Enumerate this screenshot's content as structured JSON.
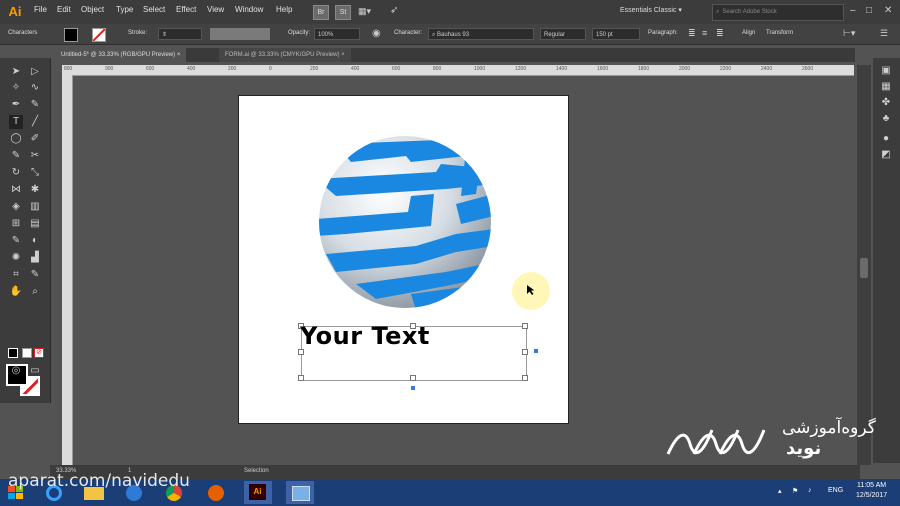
{
  "app": {
    "logo": "Ai",
    "workspace": "Essentials Classic",
    "search_placeholder": "Search Adobe Stock"
  },
  "menu": [
    "File",
    "Edit",
    "Object",
    "Type",
    "Select",
    "Effect",
    "View",
    "Window",
    "Help"
  ],
  "menubar_icons": [
    "Br",
    "St"
  ],
  "control_bar": {
    "panel_label": "Characters",
    "stroke_label": "Stroke:",
    "opacity_label": "Opacity:",
    "opacity_value": "100%",
    "character_label": "Character:",
    "font_name": "Bauhaus 93",
    "font_style": "Regular",
    "font_size": "150 pt",
    "paragraph_label": "Paragraph:",
    "align_label": "Align",
    "transform_label": "Transform"
  },
  "tabs": [
    {
      "label": "Untitled-5* @ 33.33% (RGB/GPU Preview)",
      "close": "×"
    },
    {
      "label": "FORM.ai @ 33.33% (CMYK/GPU Preview)",
      "close": "×"
    }
  ],
  "ruler_ticks": [
    "800",
    "900",
    "600",
    "400",
    "200",
    "0",
    "200",
    "400",
    "600",
    "800",
    "1000",
    "1200",
    "1400",
    "1600",
    "1800",
    "2000",
    "2200",
    "2400",
    "2600"
  ],
  "canvas": {
    "text": "Your Text"
  },
  "statusbar": {
    "zoom": "33.33%",
    "artboard": "1",
    "tool": "Selection"
  },
  "taskbar": {
    "language": "ENG",
    "time": "11:05 AM",
    "date": "12/5/2017"
  },
  "watermark": "aparat.com/navidedu",
  "brand": {
    "line1": "گروه‌آموزشی",
    "line2": "نوید"
  },
  "colors": {
    "sphere_blue": "#1a88e0",
    "sphere_light": "#cfd8e2",
    "taskbar": "#1b3e76",
    "ai_orange": "#ff9a00"
  }
}
